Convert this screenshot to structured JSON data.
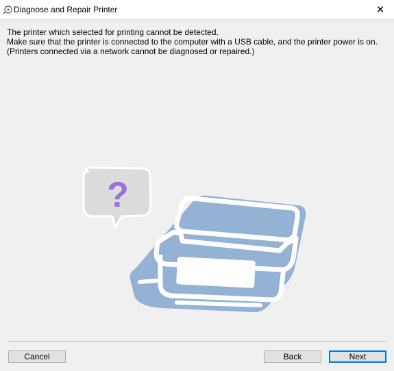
{
  "window": {
    "title": "Diagnose and Repair Printer",
    "close_label": "✕"
  },
  "message": {
    "line1": "The printer which selected for printing cannot be detected.",
    "line2": "Make sure that the printer is connected to the computer with a USB cable, and the printer power is on.",
    "line3": "(Printers connected via a network cannot be diagnosed or repaired.)"
  },
  "illustration": {
    "bubble_text": "?",
    "bubble_color": "#dcdcdc",
    "question_color": "#9b72d8",
    "printer_color": "#93b2d4"
  },
  "buttons": {
    "cancel": "Cancel",
    "back": "Back",
    "next": "Next"
  }
}
